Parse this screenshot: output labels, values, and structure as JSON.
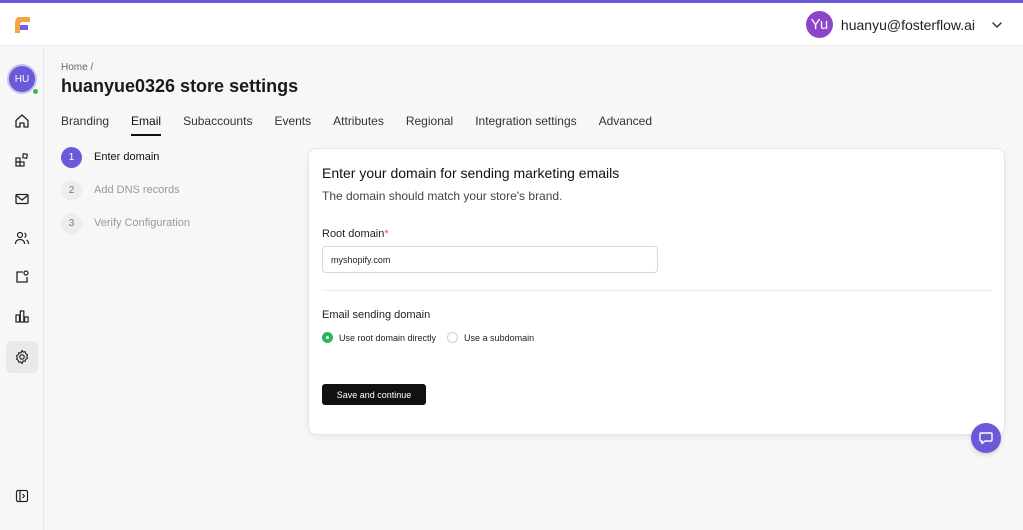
{
  "header": {
    "logo_icon": "fosterflow-logo-icon",
    "user_avatar_text": "Yu",
    "user_email": "huanyu@fosterflow.ai",
    "chevron_icon": "chevron-down-icon"
  },
  "sidebar": {
    "avatar_text": "HU",
    "items": [
      {
        "icon": "home-icon"
      },
      {
        "icon": "blocks-icon"
      },
      {
        "icon": "mail-icon"
      },
      {
        "icon": "users-icon"
      },
      {
        "icon": "badge-icon"
      },
      {
        "icon": "bar-chart-icon"
      },
      {
        "icon": "gear-icon"
      },
      {
        "icon": "collapse-sidebar-icon"
      }
    ]
  },
  "breadcrumb": "Home  /",
  "page_title": "huanyue0326 store settings",
  "tabs": [
    "Branding",
    "Email",
    "Subaccounts",
    "Events",
    "Attributes",
    "Regional",
    "Integration settings",
    "Advanced"
  ],
  "active_tab": "Email",
  "steps": [
    {
      "num": "1",
      "label": "Enter domain"
    },
    {
      "num": "2",
      "label": "Add DNS records"
    },
    {
      "num": "3",
      "label": "Verify Configuration"
    }
  ],
  "card": {
    "title": "Enter your domain for sending marketing emails",
    "subtitle": "The domain should match your store's brand.",
    "root_domain_label": "Root domain",
    "required_mark": "*",
    "root_domain_value": "myshopify.com",
    "sending_domain_label": "Email sending domain",
    "radio_options": [
      "Use root domain directly",
      "Use a subdomain"
    ],
    "selected_radio": "Use root domain directly",
    "save_label": "Save and continue"
  },
  "colors": {
    "accent": "#6a5ad8",
    "success": "#2fb55b",
    "user_avatar": "#8e44c8"
  }
}
